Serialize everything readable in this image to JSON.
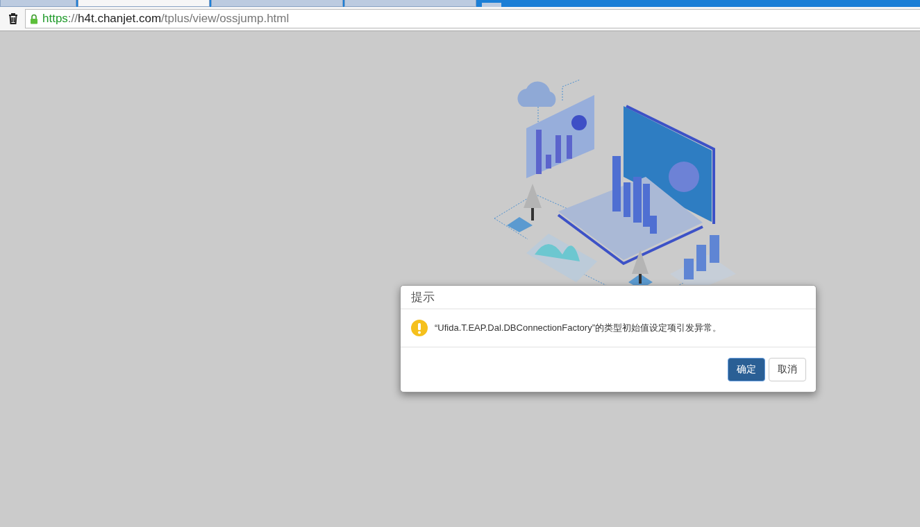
{
  "browser": {
    "tabs": [
      {
        "selected": false
      },
      {
        "selected": true
      },
      {
        "selected": false
      },
      {
        "selected": false
      }
    ],
    "address": {
      "scheme": "https",
      "separator": "://",
      "host": "h4t.chanjet.com",
      "path": "/tplus/view/ossjump.html",
      "secure": true
    }
  },
  "dialog": {
    "title": "提示",
    "message": "“Ufida.T.EAP.Dal.DBConnectionFactory”的类型初始值设定项引发异常。",
    "kind": "warning",
    "buttons": [
      {
        "label": "确定",
        "kind": "primary"
      },
      {
        "label": "取消",
        "kind": "default"
      }
    ]
  }
}
